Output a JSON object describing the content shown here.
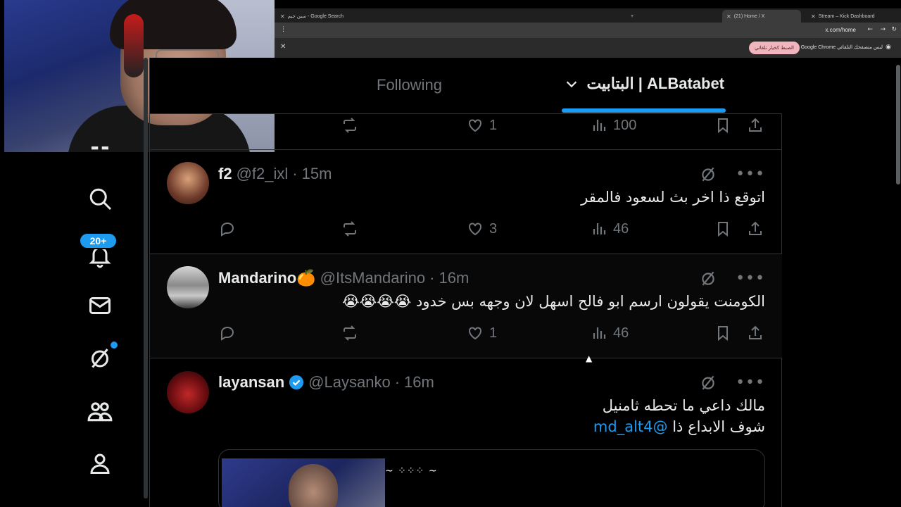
{
  "browser": {
    "tabs": [
      {
        "label": "Stream – Kick Dashboard"
      },
      {
        "label": "(21) Home / X"
      },
      {
        "label": "سين جيم - Google Search"
      }
    ],
    "url": "x.com/home",
    "infobar_text": "Google Chrome ليس متصفحك التلقائي",
    "infobar_button": "الضبط كخيار تلقائي"
  },
  "nav": {
    "notifications_badge": "20+"
  },
  "header": {
    "following_label": "Following",
    "list_label": "البتابيت | ALBatabet"
  },
  "top_actions": {
    "likes": "1",
    "views": "100"
  },
  "tweets": [
    {
      "name": "f2",
      "handle": "@f2_ixl",
      "time": "15m",
      "text": "اتوقع ذا اخر بث لسعود فالمقر",
      "likes": "3",
      "views": "46"
    },
    {
      "name": "Mandarino🍊",
      "handle": "@ItsMandarino",
      "time": "16m",
      "text": "الكومنت يقولون ارسم ابو فالح اسهل لان وجهه بس خدود 😭😭😭😭",
      "likes": "1",
      "views": "46"
    },
    {
      "name": "layansan",
      "handle": "@Laysanko",
      "time": "16m",
      "text_line1": "مالك داعي ما تحطه ثامنيل",
      "text_line2": "شوف الابداع ذا",
      "mention": "@md_alt4"
    }
  ],
  "colors": {
    "accent": "#1d9bf0",
    "muted": "#71767b",
    "border": "#2f3336"
  }
}
